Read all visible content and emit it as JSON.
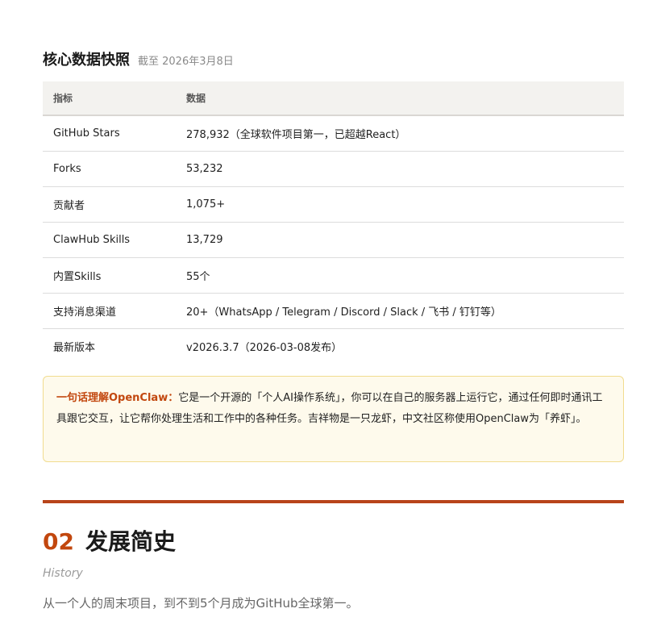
{
  "snapshot": {
    "title": "核心数据快照",
    "date": "截至 2026年3月8日"
  },
  "table": {
    "headers": [
      "指标",
      "数据"
    ],
    "rows": [
      {
        "metric": "GitHub Stars",
        "value": "278,932（全球软件项目第一，已超越React）"
      },
      {
        "metric": "Forks",
        "value": "53,232"
      },
      {
        "metric": "贡献者",
        "value": "1,075+"
      },
      {
        "metric": "ClawHub Skills",
        "value": "13,729"
      },
      {
        "metric": "内置Skills",
        "value": "55个"
      },
      {
        "metric": "支持消息渠道",
        "value": "20+（WhatsApp / Telegram / Discord / Slack / 飞书 / 钉钉等）"
      },
      {
        "metric": "最新版本",
        "value": "v2026.3.7（2026-03-08发布）"
      }
    ]
  },
  "callout": {
    "lead": "一句话理解OpenClaw：",
    "body": "它是一个开源的「个人AI操作系统」，你可以在自己的服务器上运行它，通过任何即时通讯工具跟它交互，让它帮你处理生活和工作中的各种任务。吉祥物是一只龙虾，中文社区称使用OpenClaw为「养虾」。"
  },
  "section": {
    "number": "02",
    "title": "发展简史",
    "subtitle": "History",
    "lead": "从一个人的周末项目，到不到5个月成为GitHub全球第一。"
  },
  "colors": {
    "accent": "#c2470e",
    "rule": "#b8441a",
    "callout_bg": "#fefaec",
    "callout_border": "#f1dc8f",
    "table_header_bg": "#f3f2ef"
  }
}
